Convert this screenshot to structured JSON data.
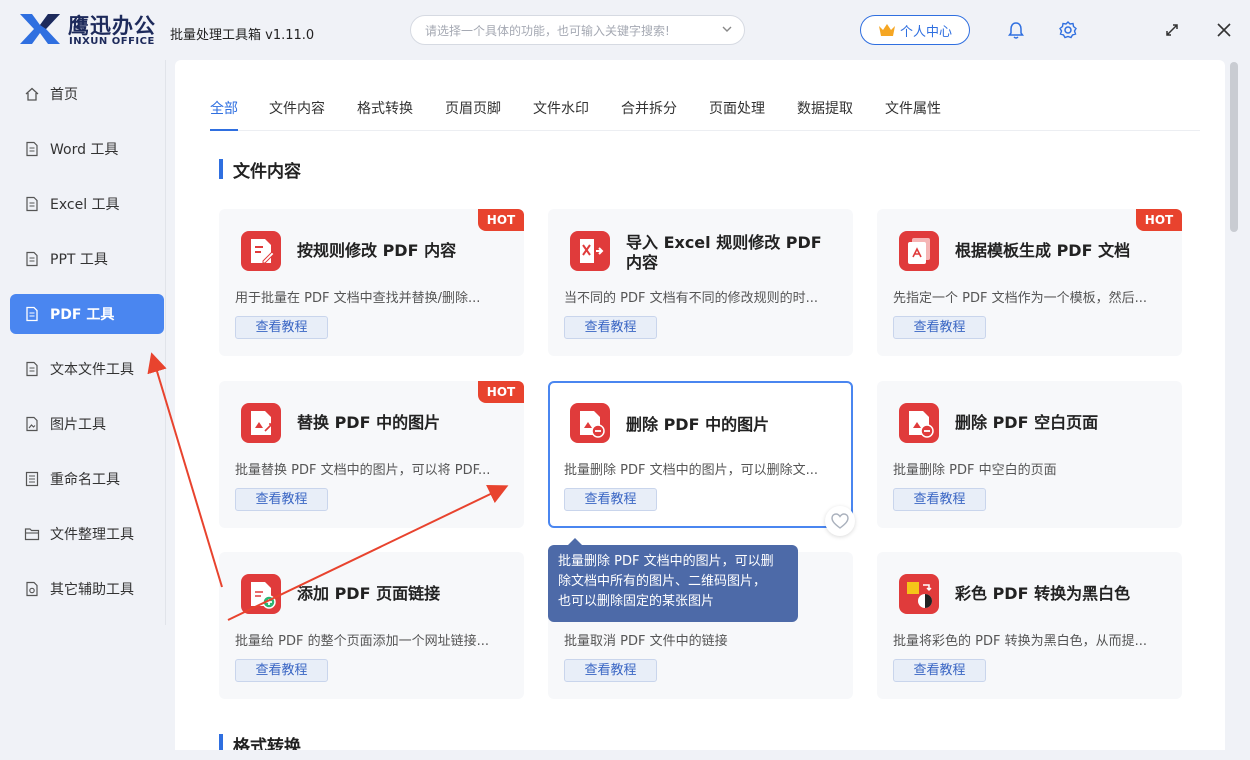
{
  "brand": {
    "name_cn": "鹰迅办公",
    "name_en": "INXUN OFFICE"
  },
  "app_title": "批量处理工具箱 v1.11.0",
  "search": {
    "placeholder": "请选择一个具体的功能，也可输入关键字搜索!"
  },
  "user_center": {
    "label": "个人中心"
  },
  "colors": {
    "accent": "#2f6fe0",
    "sidebar_active": "#4a86f0",
    "hot": "#e8432e",
    "icon_red": "#e03b3b",
    "tooltip": "#4d6aa8",
    "arrow": "#e8432e"
  },
  "sidebar": {
    "items": [
      {
        "label": "首页",
        "icon": "home-icon"
      },
      {
        "label": "Word 工具",
        "icon": "document-icon"
      },
      {
        "label": "Excel 工具",
        "icon": "document-icon"
      },
      {
        "label": "PPT 工具",
        "icon": "document-icon"
      },
      {
        "label": "PDF 工具",
        "icon": "document-icon",
        "active": true
      },
      {
        "label": "文本文件工具",
        "icon": "document-icon"
      },
      {
        "label": "图片工具",
        "icon": "image-file-icon"
      },
      {
        "label": "重命名工具",
        "icon": "list-file-icon"
      },
      {
        "label": "文件整理工具",
        "icon": "folder-icon"
      },
      {
        "label": "其它辅助工具",
        "icon": "tools-file-icon"
      }
    ]
  },
  "tabs": [
    "全部",
    "文件内容",
    "格式转换",
    "页眉页脚",
    "文件水印",
    "合并拆分",
    "页面处理",
    "数据提取",
    "文件属性"
  ],
  "sections": [
    {
      "title": "文件内容"
    },
    {
      "title": "格式转换"
    }
  ],
  "cards": [
    {
      "title": "按规则修改 PDF 内容",
      "desc": "用于批量在 PDF 文档中查找并替换/删除...",
      "button": "查看教程",
      "hot": "HOT",
      "icon": "pdf-edit-icon"
    },
    {
      "title": "导入 Excel 规则修改 PDF 内容",
      "desc": "当不同的 PDF 文档有不同的修改规则的时...",
      "button": "查看教程",
      "icon": "excel-import-icon"
    },
    {
      "title": "根据模板生成 PDF 文档",
      "desc": "先指定一个 PDF 文档作为一个模板，然后...",
      "button": "查看教程",
      "hot": "HOT",
      "icon": "pdf-template-icon"
    },
    {
      "title": "替换 PDF 中的图片",
      "desc": "批量替换 PDF 文档中的图片，可以将 PDF...",
      "button": "查看教程",
      "hot": "HOT",
      "icon": "pdf-replace-icon"
    },
    {
      "title": "删除 PDF 中的图片",
      "desc": "批量删除 PDF 文档中的图片，可以删除文...",
      "button": "查看教程",
      "icon": "pdf-delete-icon"
    },
    {
      "title": "删除 PDF 空白页面",
      "desc": "批量删除 PDF 中空白的页面",
      "button": "查看教程",
      "icon": "pdf-delete-icon"
    },
    {
      "title": "添加 PDF 页面链接",
      "desc": "批量给 PDF 的整个页面添加一个网址链接...",
      "button": "查看教程",
      "icon": "pdf-add-icon"
    },
    {
      "title": "",
      "desc": "批量取消 PDF 文件中的链接",
      "button": "查看教程",
      "icon": ""
    },
    {
      "title": "彩色 PDF 转换为黑白色",
      "desc": "批量将彩色的 PDF 转换为黑白色，从而提...",
      "button": "查看教程",
      "icon": "color-to-bw-icon"
    }
  ],
  "tooltip": {
    "lines": [
      "批量删除 PDF 文档中的图片，可以删",
      "除文档中所有的图片、二维码图片，",
      "也可以删除固定的某张图片"
    ]
  }
}
